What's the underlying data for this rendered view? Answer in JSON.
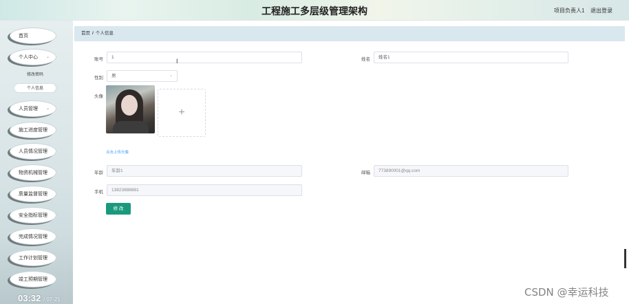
{
  "header": {
    "title": "工程施工多层级管理架构",
    "user_label": "项目负责人1",
    "logout_label": "退出登录"
  },
  "sidebar": {
    "items": [
      {
        "label": "首页"
      },
      {
        "label": "个人中心"
      },
      {
        "label": "人员管理"
      },
      {
        "label": "施工进度管理"
      },
      {
        "label": "人员情况管理"
      },
      {
        "label": "物资机械管理"
      },
      {
        "label": "质量监督管理"
      },
      {
        "label": "安全指标管理"
      },
      {
        "label": "完成情况管理"
      },
      {
        "label": "工作计划管理"
      },
      {
        "label": "竣工预期管理"
      }
    ],
    "subitems": [
      {
        "label": "修改密码"
      },
      {
        "label": "个人信息"
      }
    ],
    "clock_time": "03:32",
    "clock_date": "/ 07-21"
  },
  "breadcrumb": {
    "home": "首页",
    "separator": "/",
    "current": "个人信息"
  },
  "form": {
    "account": {
      "label": "账号",
      "value": "1"
    },
    "name": {
      "label": "姓名",
      "value": "姓名1"
    },
    "gender": {
      "label": "性别",
      "value": "男"
    },
    "avatar": {
      "label": "头像",
      "upload_icon": "+",
      "upload_hint": "点击上传头像"
    },
    "age": {
      "label": "年龄",
      "value": "年龄1"
    },
    "email": {
      "label": "邮箱",
      "value": "773890001@qq.com"
    },
    "phone": {
      "label": "手机",
      "value": "13823888881"
    },
    "submit_label": "修 改"
  },
  "watermark": "CSDN @幸运科技",
  "colors": {
    "accent": "#1a9a7c",
    "breadcrumb_bg": "#d9e8ee",
    "link": "#409eff"
  }
}
